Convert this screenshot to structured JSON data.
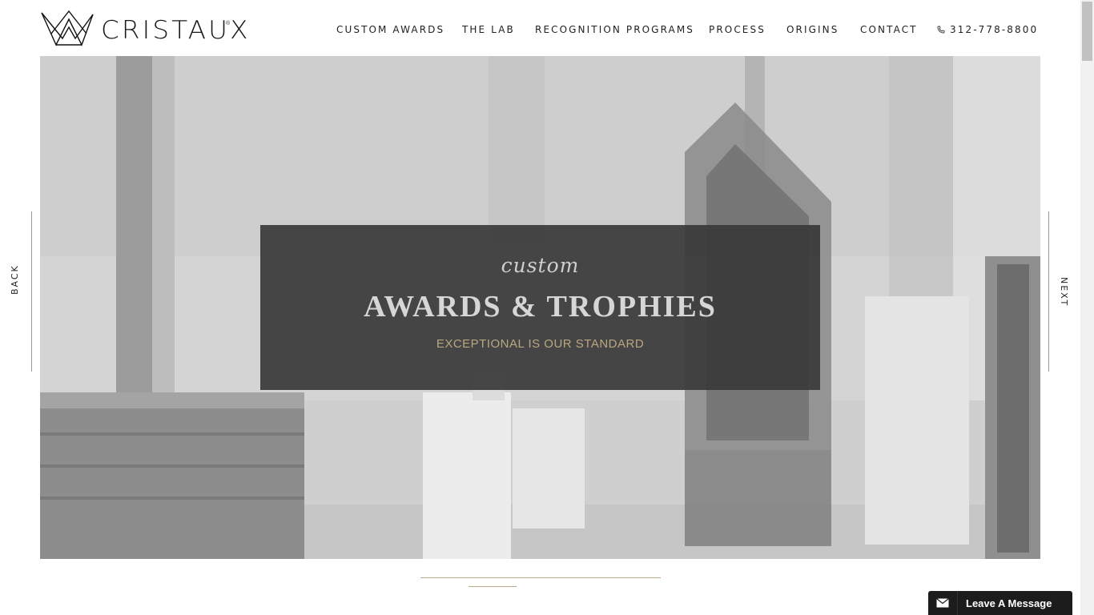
{
  "brand": {
    "name": "CRISTAUX"
  },
  "nav": {
    "items": [
      {
        "label": "CUSTOM AWARDS"
      },
      {
        "label": "THE LAB"
      },
      {
        "label": "RECOGNITION PROGRAMS"
      },
      {
        "label": "PROCESS"
      },
      {
        "label": "ORIGINS"
      },
      {
        "label": "CONTACT"
      }
    ],
    "phone": "312-778-8800",
    "phone_icon": "phone-icon"
  },
  "hero": {
    "small": "custom",
    "title": "AWARDS & TROPHIES",
    "subtitle": "EXCEPTIONAL IS OUR STANDARD"
  },
  "slider": {
    "back": "BACK",
    "next": "NEXT"
  },
  "message": {
    "label": "Leave A Message",
    "icon": "envelope-icon"
  },
  "colors": {
    "accent": "#b9a782",
    "panel": "#3a3a3a"
  }
}
